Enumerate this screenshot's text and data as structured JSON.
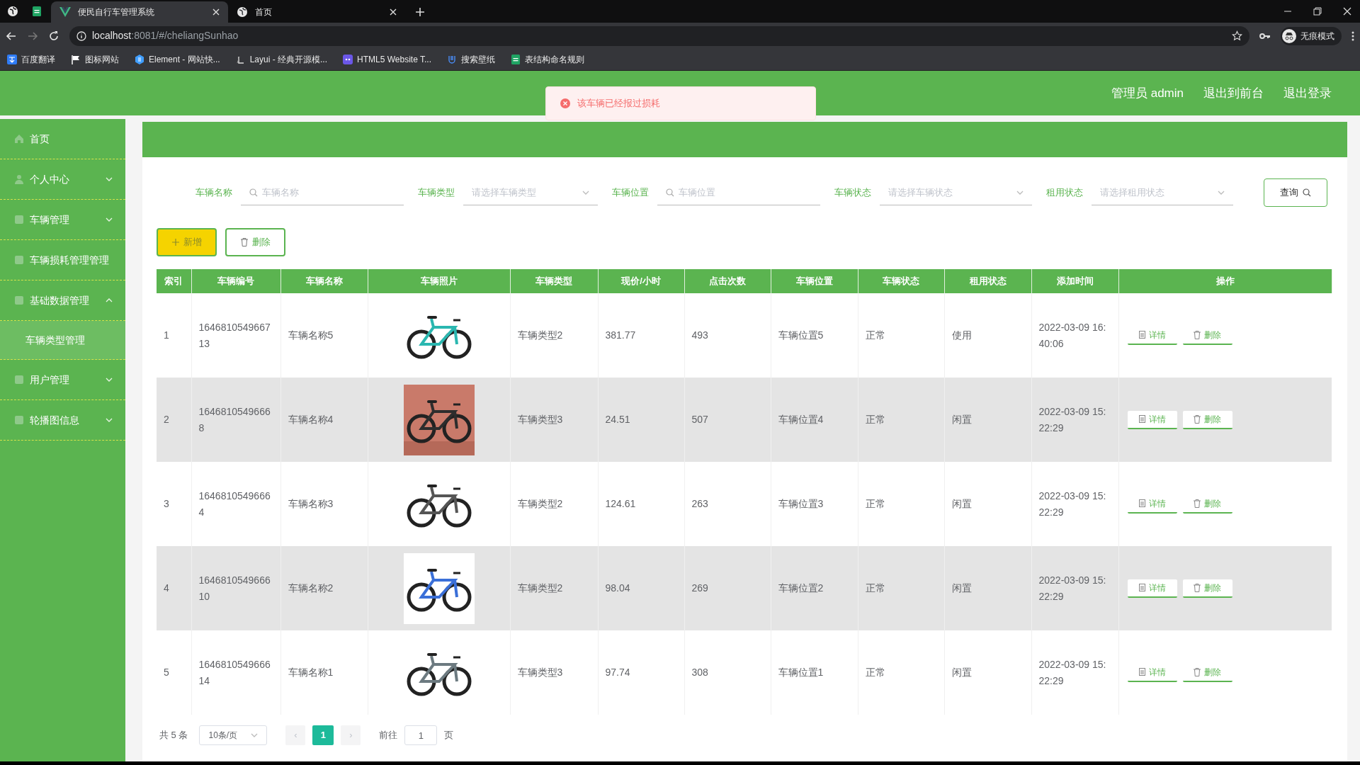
{
  "browser": {
    "tabs": [
      {
        "title": "便民自行车管理系统",
        "selected": true
      },
      {
        "title": "首页",
        "selected": false
      }
    ],
    "address_host": "localhost",
    "address_path": ":8081/#/cheliangSunhao",
    "profile": "无痕模式",
    "bookmarks": [
      "百度翻译",
      "图标网站",
      "Element - 网站快...",
      "Layui - 经典开源模...",
      "HTML5 Website T...",
      "搜索壁纸",
      "表结构命名规则"
    ]
  },
  "header": {
    "user": "管理员 admin",
    "links": [
      "退出到前台",
      "退出登录"
    ]
  },
  "toast": {
    "message": "该车辆已经报过损耗"
  },
  "sidebar": {
    "items": [
      {
        "label": "首页",
        "kind": "link"
      },
      {
        "label": "个人中心",
        "kind": "menu",
        "expanded": false
      },
      {
        "label": "车辆管理",
        "kind": "menu",
        "expanded": false
      },
      {
        "label": "车辆损耗管理管理",
        "kind": "link"
      },
      {
        "label": "基础数据管理",
        "kind": "menu",
        "expanded": true,
        "children": [
          {
            "label": "车辆类型管理"
          }
        ]
      },
      {
        "label": "用户管理",
        "kind": "menu",
        "expanded": false
      },
      {
        "label": "轮播图信息",
        "kind": "menu",
        "expanded": false
      }
    ]
  },
  "filters": [
    {
      "label": "车辆名称",
      "kind": "search",
      "placeholder": "车辆名称"
    },
    {
      "label": "车辆类型",
      "kind": "select",
      "placeholder": "请选择车辆类型"
    },
    {
      "label": "车辆位置",
      "kind": "search",
      "placeholder": "车辆位置"
    },
    {
      "label": "车辆状态",
      "kind": "select",
      "placeholder": "请选择车辆状态"
    },
    {
      "label": "租用状态",
      "kind": "select",
      "placeholder": "请选择租用状态"
    }
  ],
  "search_button": "查询",
  "actions": [
    {
      "label": "新增",
      "kind": "add"
    },
    {
      "label": "删除",
      "kind": "delete"
    }
  ],
  "table": {
    "columns": [
      "索引",
      "车辆编号",
      "车辆名称",
      "车辆照片",
      "车辆类型",
      "现价/小时",
      "点击次数",
      "车辆位置",
      "车辆状态",
      "租用状态",
      "添加时间",
      "操作"
    ],
    "rows": [
      {
        "cells": [
          "1",
          "164681054966713",
          "车辆名称5",
          {
            "kind": "picture"
          },
          "车辆类型2",
          "381.77",
          "493",
          "车辆位置5",
          "正常",
          "使用",
          "2022-03-09 16:40:06"
        ],
        "actions": [
          "详情",
          "删除"
        ]
      },
      {
        "cells": [
          "2",
          "16468105496668",
          "车辆名称4",
          {
            "kind": "picture"
          },
          "车辆类型3",
          "24.51",
          "507",
          "车辆位置4",
          "正常",
          "闲置",
          "2022-03-09 15:22:29"
        ],
        "actions": [
          "详情",
          "删除"
        ]
      },
      {
        "cells": [
          "3",
          "16468105496664",
          "车辆名称3",
          {
            "kind": "picture"
          },
          "车辆类型2",
          "124.61",
          "263",
          "车辆位置3",
          "正常",
          "闲置",
          "2022-03-09 15:22:29"
        ],
        "actions": [
          "详情",
          "删除"
        ]
      },
      {
        "cells": [
          "4",
          "164681054966610",
          "车辆名称2",
          {
            "kind": "picture"
          },
          "车辆类型2",
          "98.04",
          "269",
          "车辆位置2",
          "正常",
          "闲置",
          "2022-03-09 15:22:29"
        ],
        "actions": [
          "详情",
          "删除"
        ]
      },
      {
        "cells": [
          "5",
          "164681054966614",
          "车辆名称1",
          {
            "kind": "picture"
          },
          "车辆类型3",
          "97.74",
          "308",
          "车辆位置1",
          "正常",
          "闲置",
          "2022-03-09 15:22:29"
        ],
        "actions": [
          "详情",
          "删除"
        ]
      }
    ]
  },
  "pagination": {
    "total": "共 5 条",
    "page_size": "10条/页",
    "prev": "‹",
    "next": "›",
    "pages": [
      {
        "label": "1",
        "selected": true
      }
    ],
    "goto_label": "前往",
    "goto_value": "1",
    "goto_unit": "页"
  }
}
